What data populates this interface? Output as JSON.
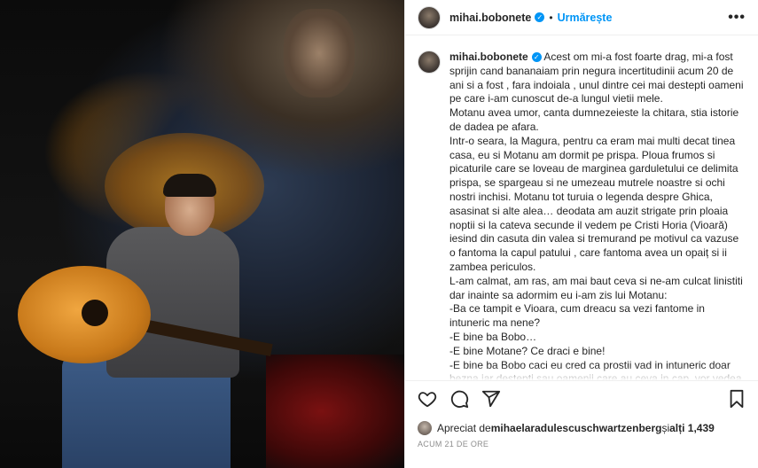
{
  "post": {
    "username": "mihai.bobonete",
    "follow_label": "Urmărește",
    "dot": "•",
    "more_label": "•••",
    "verified_mark": "✓"
  },
  "caption": {
    "author": "mihai.bobonete",
    "paragraphs": [
      " Acest om mi-a fost foarte drag, mi-a fost sprijin cand bananaiam prin negura incertitudinii acum 20 de ani si a fost , fara indoiala , unul dintre cei mai destepti oameni pe care i-am cunoscut de-a lungul vietii mele.",
      "Motanu avea umor, canta dumnezeieste la chitara, stia istorie de dadea pe afara.",
      "Intr-o seara, la Magura, pentru ca eram mai multi decat tinea casa, eu si Motanu am dormit pe prispa. Ploua frumos si picaturile care se loveau de marginea garduletului ce delimita prispa, se spargeau si ne umezeau mutrele noastre si ochi nostri inchisi. Motanu tot turuia o legenda despre Ghica, asasinat si alte alea… deodata am auzit strigate prin ploaia noptii si la cateva secunde il vedem pe Cristi Horia (Vioară) iesind din casuta din valea si tremurand pe motivul ca vazuse o fantoma la capul patului , care fantoma avea un opaiț si ii zambea periculos.",
      "L-am calmat, am ras, am mai baut ceva si ne-am culcat linistiti dar inainte sa adormim eu i-am zis lui Motanu:",
      "-Ba ce tampit e Vioara, cum dreacu sa vezi fantome in intuneric ma nene?",
      "-E bine ba Bobo…",
      "-E bine Motane? Ce draci e bine!",
      "-E bine ba Bobo caci eu cred ca prostii vad in intuneric doar bezna iar destepti sau oamenii care au ceva in cap, vor vedea tot timpul ceva in intuneric…"
    ]
  },
  "likes": {
    "prefix": "Apreciat de ",
    "user": "mihaelaradulescuschwartzenberg",
    "middle": " și ",
    "others": "alți 1,439"
  },
  "timestamp": "ACUM 21 DE ORE",
  "icons": [
    "heart-icon",
    "comment-icon",
    "share-icon",
    "bookmark-icon"
  ],
  "colors": {
    "accent": "#0095f6",
    "text": "#262626",
    "muted": "#8e8e8e"
  }
}
